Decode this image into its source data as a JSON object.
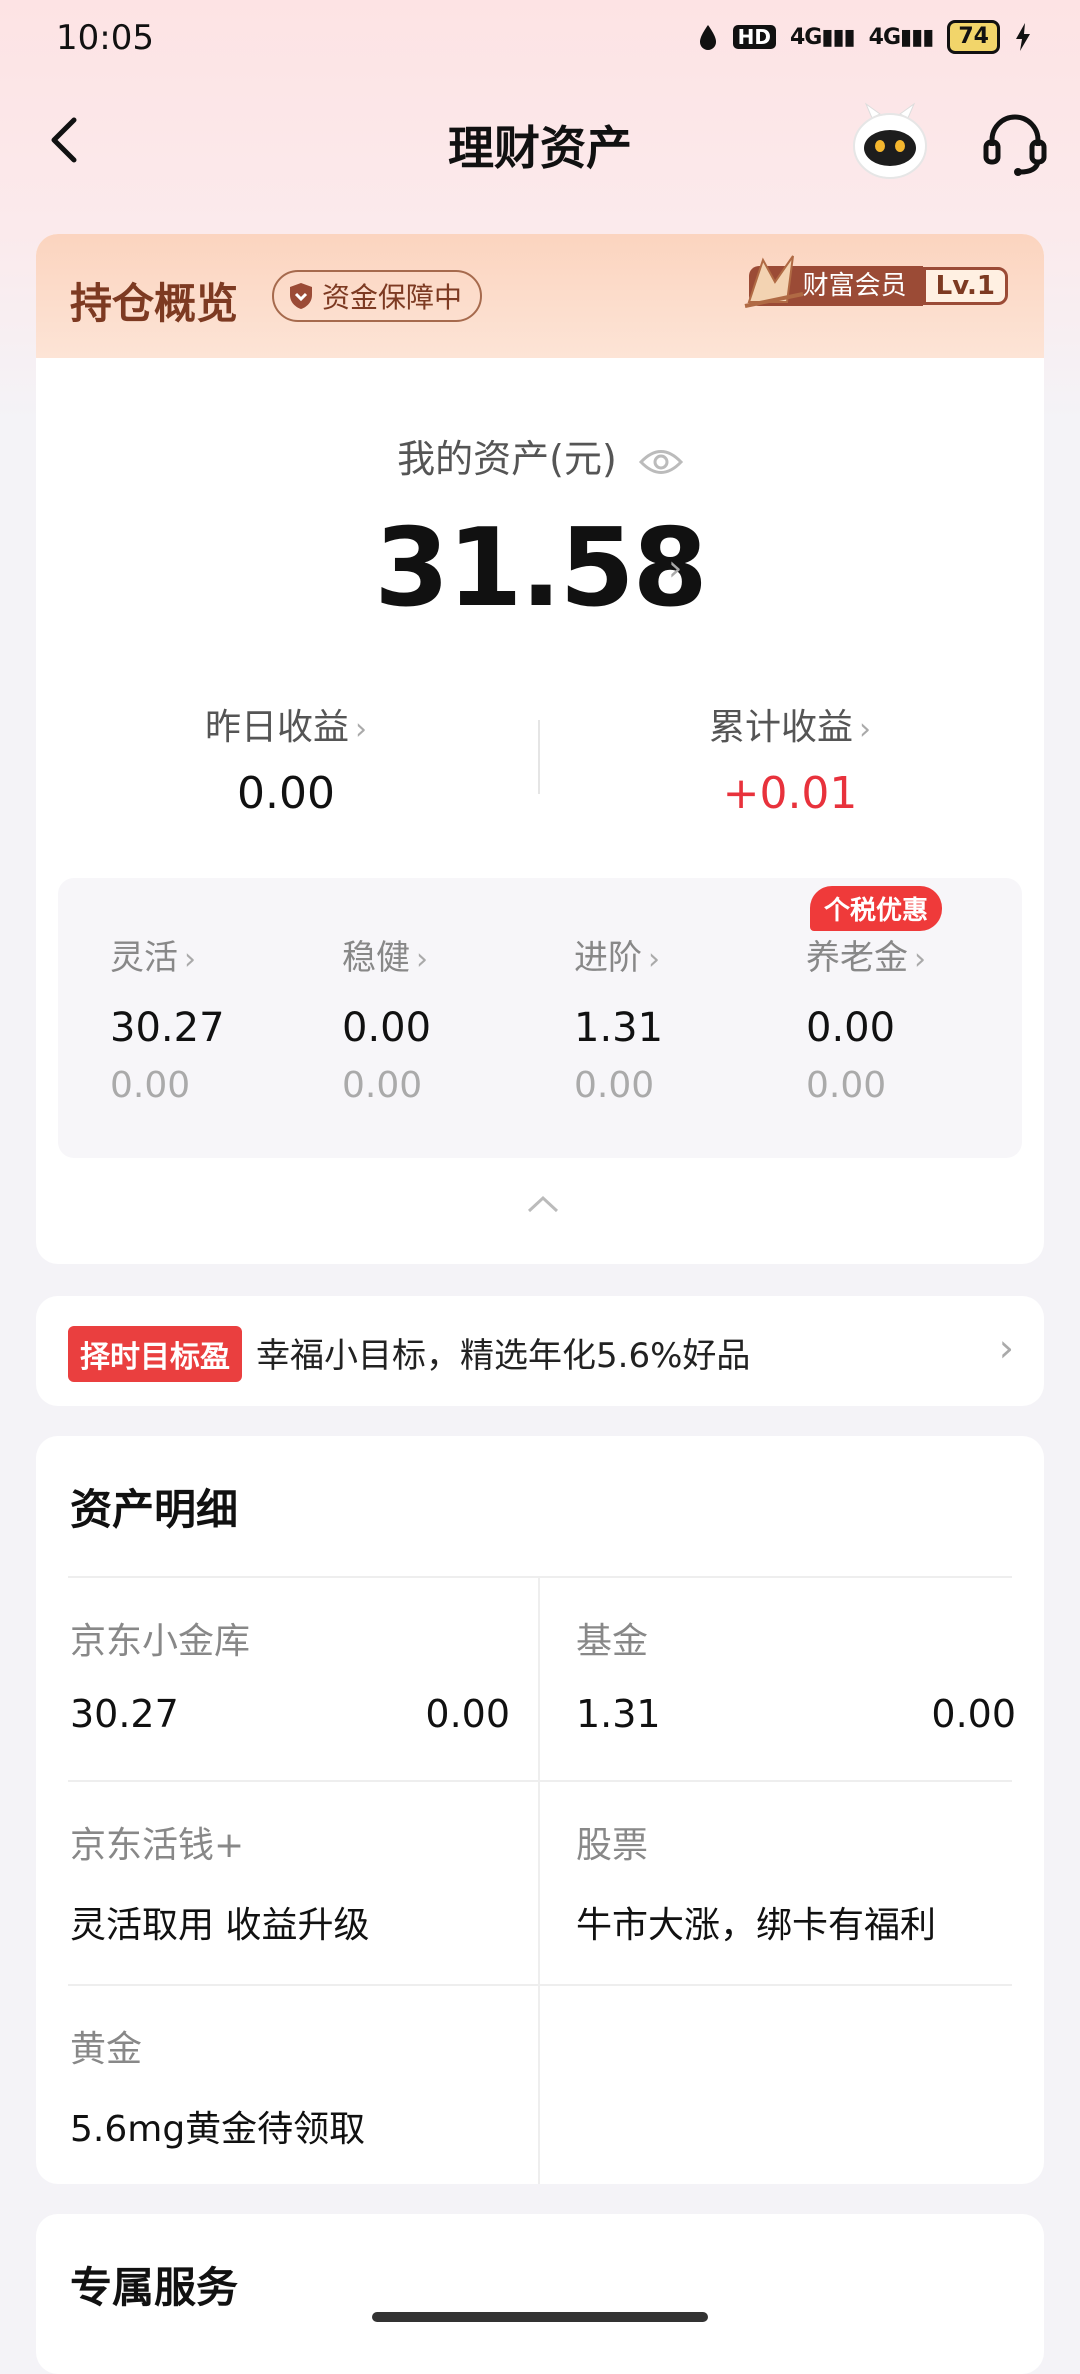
{
  "status_bar": {
    "time": "10:05",
    "hd": "HD",
    "net1": "4G",
    "net2": "4G",
    "battery": "74"
  },
  "header": {
    "title": "理财资产"
  },
  "overview": {
    "title": "持仓概览",
    "guarantee": "资金保障中",
    "member_label": "财富会员",
    "member_level": "Lv.1",
    "assets_label": "我的资产(元)",
    "assets_value": "31.58",
    "yesterday_label": "昨日收益",
    "yesterday_value": "0.00",
    "total_label": "累计收益",
    "total_value": "+0.01",
    "categories": [
      {
        "label": "灵活",
        "value": "30.27",
        "sub": "0.00"
      },
      {
        "label": "稳健",
        "value": "0.00",
        "sub": "0.00"
      },
      {
        "label": "进阶",
        "value": "1.31",
        "sub": "0.00"
      },
      {
        "label": "养老金",
        "value": "0.00",
        "sub": "0.00"
      }
    ],
    "tax_badge": "个税优惠"
  },
  "promo": {
    "tag": "择时目标盈",
    "text": "幸福小目标，精选年化5.6%好品"
  },
  "detail": {
    "title": "资产明细",
    "items": [
      {
        "name": "京东小金库",
        "value": "30.27",
        "income": "0.00"
      },
      {
        "name": "基金",
        "value": "1.31",
        "income": "0.00"
      },
      {
        "name": "京东活钱+",
        "desc": "灵活取用 收益升级"
      },
      {
        "name": "股票",
        "desc": "牛市大涨，绑卡有福利"
      },
      {
        "name": "黄金",
        "desc": "5.6mg黄金待领取"
      }
    ]
  },
  "service": {
    "title": "专属服务"
  },
  "colors": {
    "accent_red": "#e8323c",
    "brown": "#7d3a22"
  }
}
